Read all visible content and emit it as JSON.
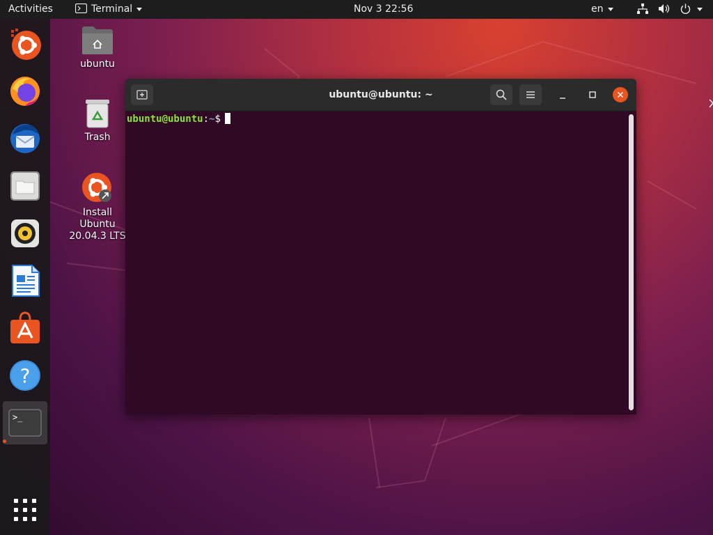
{
  "topbar": {
    "activities": "Activities",
    "app_menu": "Terminal",
    "clock": "Nov 3  22:56",
    "lang": "en"
  },
  "dock": {
    "items": [
      {
        "name": "Install Ubuntu"
      },
      {
        "name": "Firefox"
      },
      {
        "name": "Thunderbird"
      },
      {
        "name": "Files"
      },
      {
        "name": "Rhythmbox"
      },
      {
        "name": "LibreOffice Writer"
      },
      {
        "name": "Ubuntu Software"
      },
      {
        "name": "Help"
      },
      {
        "name": "Terminal"
      },
      {
        "name": "Show Applications"
      }
    ]
  },
  "desktop": {
    "home_label": "ubuntu",
    "trash_label": "Trash",
    "installer_label_1": "Install Ubuntu",
    "installer_label_2": "20.04.3 LTS"
  },
  "terminal": {
    "title": "ubuntu@ubuntu: ~",
    "prompt_user": "ubuntu@ubuntu",
    "prompt_colon": ":",
    "prompt_path": "~",
    "prompt_symbol": "$"
  },
  "colors": {
    "terminal_bg": "#300a24",
    "prompt_user": "#8ae234",
    "prompt_path": "#729fcf",
    "accent": "#e95420"
  }
}
